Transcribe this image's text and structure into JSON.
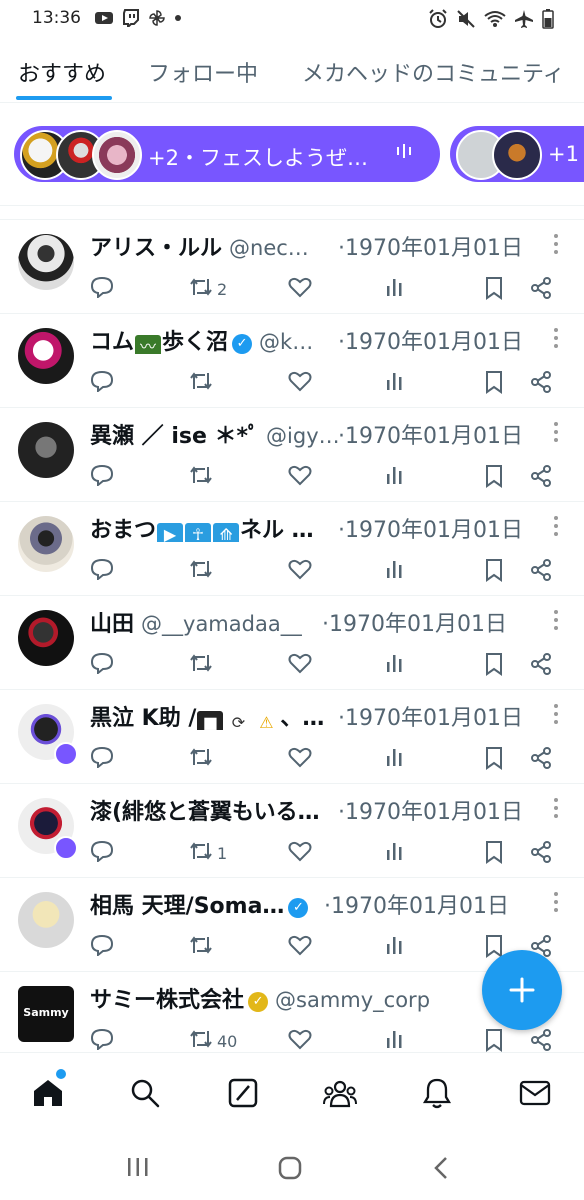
{
  "status_bar": {
    "time": "13:36"
  },
  "tabs": [
    {
      "label": "おすすめ",
      "active": true
    },
    {
      "label": "フォロー中",
      "active": false
    },
    {
      "label": "メカヘッドのコミュニティ",
      "active": false
    }
  ],
  "spaces": [
    {
      "count_text": "+2・フェスしようぜ…",
      "quote": "\""
    },
    {
      "count_text": "+1"
    }
  ],
  "tweets": [
    {
      "name": "アリス・ルル",
      "handle": "@nec…",
      "time": "·1970年01月01日",
      "verified": "",
      "retweets": "2"
    },
    {
      "name": "コム",
      "name_suffix": "歩く沼",
      "handle": "@k…",
      "time": "·1970年01月01日",
      "verified": "blue",
      "retweets": ""
    },
    {
      "name": "異瀬 ／ ise ＊*ﾟ",
      "handle": "@igy…",
      "time": "·1970年01月01日",
      "verified": "",
      "retweets": ""
    },
    {
      "name": "おまつ",
      "name_suffix": "ネル …",
      "handle": "",
      "time": "·1970年01月01日",
      "verified": "",
      "retweets": ""
    },
    {
      "name": "山田",
      "handle": "@__yamadaa__",
      "time": "·1970年01月01日",
      "verified": "",
      "retweets": ""
    },
    {
      "name": "黒泣 K助 /",
      "name_suffix": "、…",
      "handle": "",
      "time": "·1970年01月01日",
      "verified": "",
      "retweets": ""
    },
    {
      "name": "漆(緋悠と蒼翼もいる…",
      "handle": "",
      "time": "·1970年01月01日",
      "verified": "",
      "retweets": "1"
    },
    {
      "name": "相馬 天理/Soma…",
      "handle": "",
      "time": "·1970年01月01日",
      "verified": "blue",
      "retweets": ""
    },
    {
      "name": "サミー株式会社",
      "handle": "@sammy_corp",
      "time": "",
      "verified": "gold",
      "retweets": "40",
      "avatar_text": "Sammy"
    }
  ],
  "colors": {
    "accent": "#1d9bf0",
    "spaces": "#7856ff",
    "text": "#0f1419",
    "muted": "#536471"
  },
  "bottom_nav": [
    "home-icon",
    "search-icon",
    "grok-icon",
    "communities-icon",
    "notifications-icon",
    "messages-icon"
  ]
}
